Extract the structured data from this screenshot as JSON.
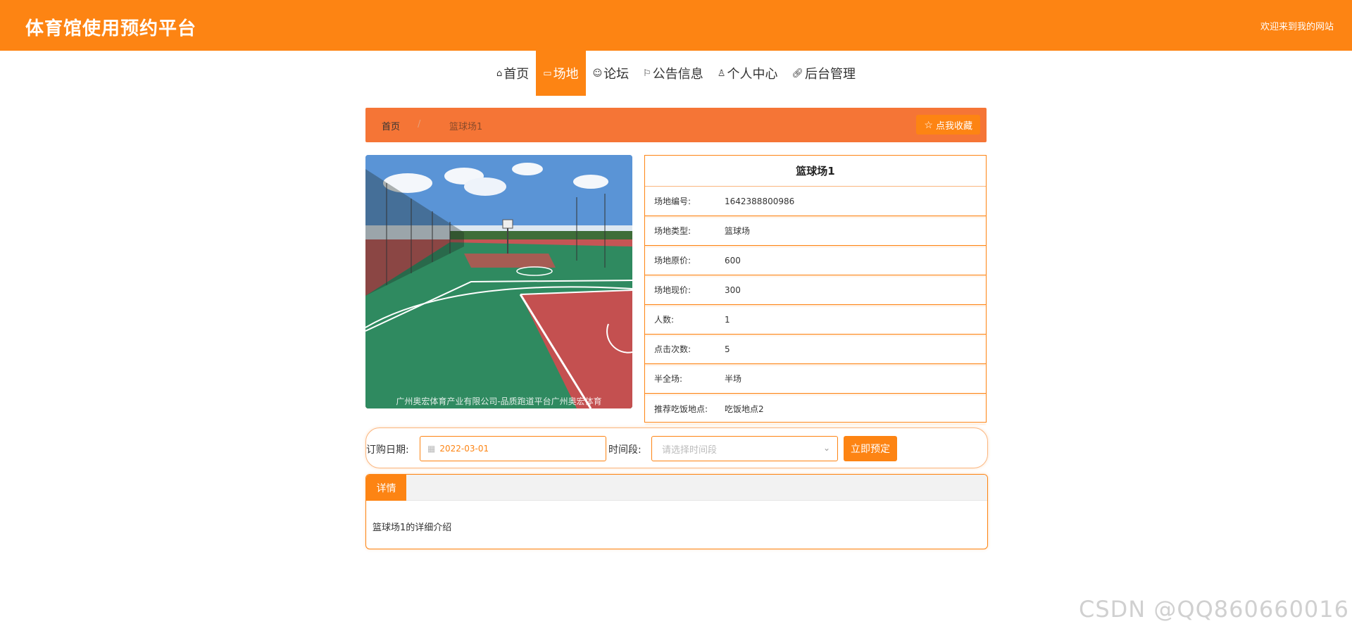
{
  "header": {
    "site_title": "体育馆使用预约平台",
    "welcome": "欢迎来到我的网站",
    "bg_color": "#fd8413"
  },
  "nav": {
    "active": "场地",
    "items": [
      {
        "label": "首页",
        "icon": "home-icon"
      },
      {
        "label": "场地",
        "icon": "venue-icon"
      },
      {
        "label": "论坛",
        "icon": "forum-icon"
      },
      {
        "label": "公告信息",
        "icon": "flag-icon"
      },
      {
        "label": "个人中心",
        "icon": "user-icon"
      },
      {
        "label": "后台管理",
        "icon": "link-icon"
      }
    ]
  },
  "breadcrumb": {
    "home": "首页",
    "separator": "/",
    "current": "篮球场1",
    "favorite_label": "点我收藏"
  },
  "photo": {
    "caption": "广州奥宏体育产业有限公司-品质跑道平台广州奥宏体育"
  },
  "venue": {
    "title": "篮球场1",
    "rows": [
      {
        "label": "场地编号:",
        "value": "1642388800986"
      },
      {
        "label": "场地类型:",
        "value": "篮球场"
      },
      {
        "label": "场地原价:",
        "value": "600"
      },
      {
        "label": "场地现价:",
        "value": "300"
      },
      {
        "label": "人数:",
        "value": "1"
      },
      {
        "label": "点击次数:",
        "value": "5"
      },
      {
        "label": "半全场:",
        "value": "半场"
      },
      {
        "label": "推荐吃饭地点:",
        "value": "吃饭地点2"
      }
    ]
  },
  "booking": {
    "date_label": "订购日期:",
    "date_value": "2022-03-01",
    "time_label": "时间段:",
    "time_placeholder": "请选择时间段",
    "reserve_label": "立即预定"
  },
  "details": {
    "tab_label": "详情",
    "text": "篮球场1的详细介绍"
  },
  "watermark": "CSDN @QQ860660016"
}
